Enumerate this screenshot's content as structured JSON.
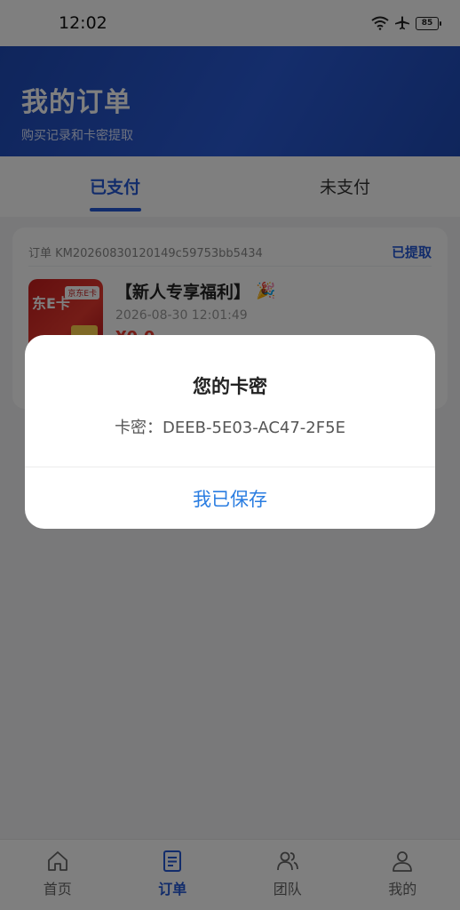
{
  "status_bar": {
    "time": "12:02",
    "battery": "85"
  },
  "header": {
    "title": "我的订单",
    "subtitle": "购买记录和卡密提取"
  },
  "tabs": [
    {
      "label": "已支付",
      "active": true
    },
    {
      "label": "未支付",
      "active": false
    }
  ],
  "order": {
    "id_text": "订单 KM20260830120149c59753bb5434",
    "status": "已提取",
    "product_name": "【新人专享福利】",
    "time": "2026-08-30 12:01:49",
    "price": "¥0.0",
    "thumb_text": "东E卡",
    "thumb_badge": "京东E卡"
  },
  "dialog": {
    "title": "您的卡密",
    "content": "卡密：DEEB-5E03-AC47-2F5E",
    "button": "我已保存"
  },
  "nav": [
    {
      "label": "首页",
      "icon": "home-icon",
      "active": false
    },
    {
      "label": "订单",
      "icon": "document-icon",
      "active": true
    },
    {
      "label": "团队",
      "icon": "team-icon",
      "active": false
    },
    {
      "label": "我的",
      "icon": "user-icon",
      "active": false
    }
  ],
  "colors": {
    "primary": "#2458d6",
    "header_bg": "#1f4bb8",
    "price": "#e83a2f",
    "dialog_button": "#2a7de1"
  }
}
